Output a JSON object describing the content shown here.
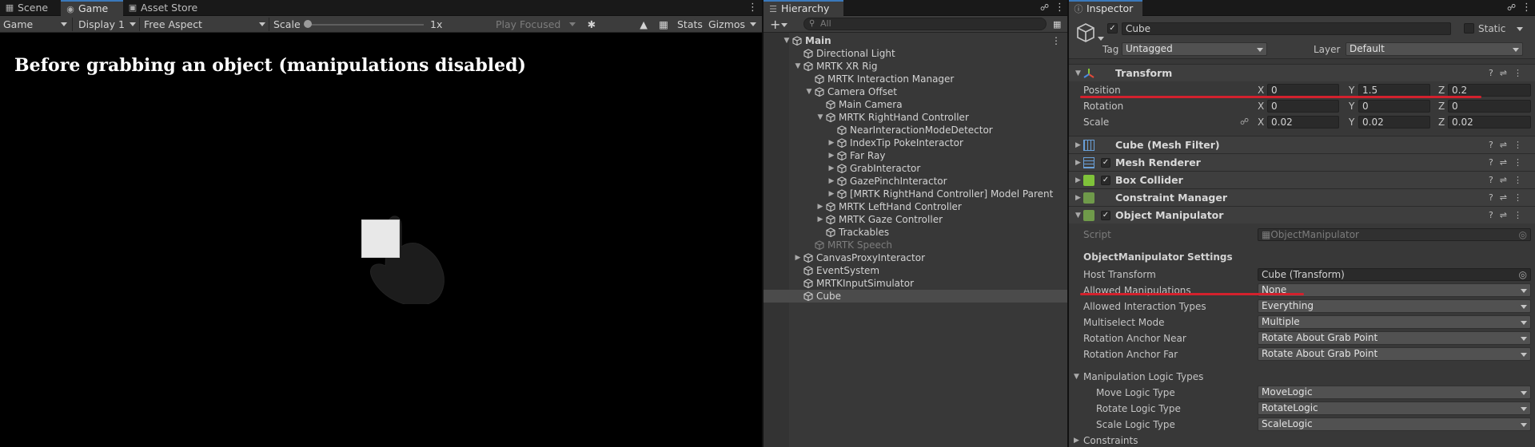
{
  "tabs": {
    "scene": "Scene",
    "game": "Game",
    "asset_store": "Asset Store",
    "hierarchy": "Hierarchy",
    "inspector": "Inspector"
  },
  "game_toolbar": {
    "view": "Game",
    "display": "Display 1",
    "aspect": "Free Aspect",
    "scale_label": "Scale",
    "scale_value": "1x",
    "play_mode": "Play Focused",
    "stats": "Stats",
    "gizmos": "Gizmos"
  },
  "game_view": {
    "caption": "Before grabbing an object (manipulations disabled)"
  },
  "hierarchy": {
    "search_placeholder": "All",
    "items": [
      {
        "label": "Main",
        "depth": 0,
        "arrow": "down",
        "scene": true
      },
      {
        "label": "Directional Light",
        "depth": 1,
        "arrow": ""
      },
      {
        "label": "MRTK XR Rig",
        "depth": 1,
        "arrow": "down"
      },
      {
        "label": "MRTK Interaction Manager",
        "depth": 2,
        "arrow": ""
      },
      {
        "label": "Camera Offset",
        "depth": 2,
        "arrow": "down"
      },
      {
        "label": "Main Camera",
        "depth": 3,
        "arrow": ""
      },
      {
        "label": "MRTK RightHand Controller",
        "depth": 3,
        "arrow": "down"
      },
      {
        "label": "NearInteractionModeDetector",
        "depth": 4,
        "arrow": ""
      },
      {
        "label": "IndexTip PokeInteractor",
        "depth": 4,
        "arrow": "right"
      },
      {
        "label": "Far Ray",
        "depth": 4,
        "arrow": "right"
      },
      {
        "label": "GrabInteractor",
        "depth": 4,
        "arrow": "right"
      },
      {
        "label": "GazePinchInteractor",
        "depth": 4,
        "arrow": "right"
      },
      {
        "label": "[MRTK RightHand Controller] Model Parent",
        "depth": 4,
        "arrow": "right"
      },
      {
        "label": "MRTK LeftHand Controller",
        "depth": 3,
        "arrow": "right"
      },
      {
        "label": "MRTK Gaze Controller",
        "depth": 3,
        "arrow": "right"
      },
      {
        "label": "Trackables",
        "depth": 3,
        "arrow": ""
      },
      {
        "label": "MRTK Speech",
        "depth": 2,
        "arrow": "",
        "dim": true
      },
      {
        "label": "CanvasProxyInteractor",
        "depth": 1,
        "arrow": "right"
      },
      {
        "label": "EventSystem",
        "depth": 1,
        "arrow": ""
      },
      {
        "label": "MRTKInputSimulator",
        "depth": 1,
        "arrow": ""
      },
      {
        "label": "Cube",
        "depth": 1,
        "arrow": "",
        "selected": true
      }
    ]
  },
  "inspector": {
    "object_name": "Cube",
    "static_label": "Static",
    "tag_label": "Tag",
    "tag_value": "Untagged",
    "layer_label": "Layer",
    "layer_value": "Default",
    "transform": {
      "title": "Transform",
      "position_label": "Position",
      "rotation_label": "Rotation",
      "scale_label": "Scale",
      "position": {
        "x": "0",
        "y": "1.5",
        "z": "0.2"
      },
      "rotation": {
        "x": "0",
        "y": "0",
        "z": "0"
      },
      "scale": {
        "x": "0.02",
        "y": "0.02",
        "z": "0.02"
      }
    },
    "components": {
      "mesh_filter": "Cube (Mesh Filter)",
      "mesh_renderer": "Mesh Renderer",
      "box_collider": "Box Collider",
      "constraint_manager": "Constraint Manager",
      "object_manipulator": "Object Manipulator"
    },
    "object_manipulator": {
      "script_label": "Script",
      "script_value": "ObjectManipulator",
      "settings_header": "ObjectManipulator Settings",
      "fields": [
        {
          "label": "Host Transform",
          "value": "Cube (Transform)",
          "kind": "object"
        },
        {
          "label": "Allowed Manipulations",
          "value": "None",
          "kind": "dropdown"
        },
        {
          "label": "Allowed Interaction Types",
          "value": "Everything",
          "kind": "dropdown"
        },
        {
          "label": "Multiselect Mode",
          "value": "Multiple",
          "kind": "dropdown"
        },
        {
          "label": "Rotation Anchor Near",
          "value": "Rotate About Grab Point",
          "kind": "dropdown"
        },
        {
          "label": "Rotation Anchor Far",
          "value": "Rotate About Grab Point",
          "kind": "dropdown"
        }
      ],
      "logic_header": "Manipulation Logic Types",
      "logic_fields": [
        {
          "label": "Move Logic Type",
          "value": "MoveLogic"
        },
        {
          "label": "Rotate Logic Type",
          "value": "RotateLogic"
        },
        {
          "label": "Scale Logic Type",
          "value": "ScaleLogic"
        }
      ],
      "constraints_header": "Constraints"
    }
  },
  "colors": {
    "accent_blue": "#3a79bb",
    "highlight_red": "#d3212d"
  }
}
